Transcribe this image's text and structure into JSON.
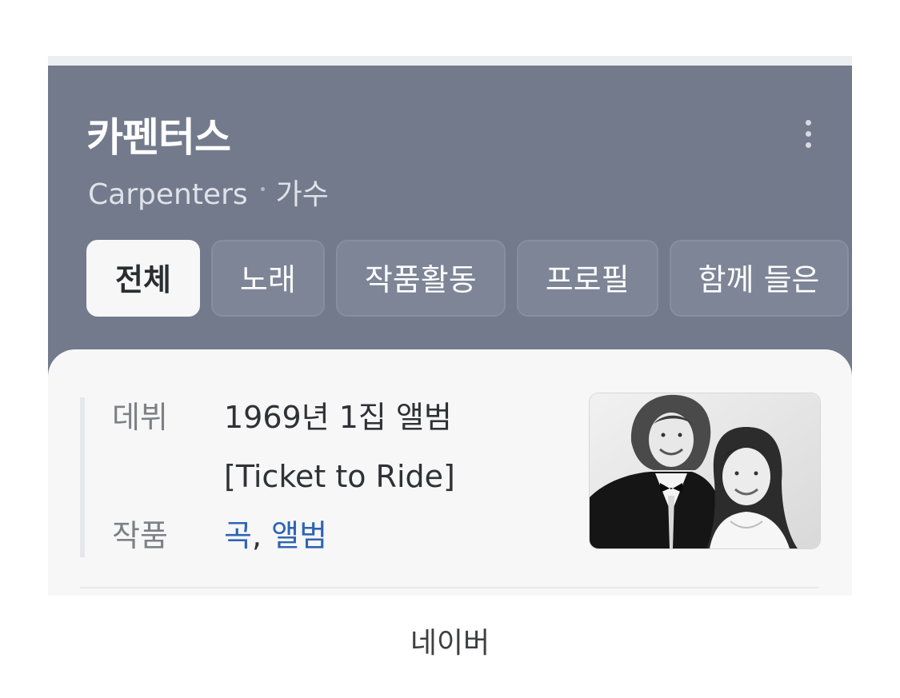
{
  "header": {
    "title": "카펜터스",
    "subtitle_name": "Carpenters",
    "subtitle_type": "가수",
    "more_icon": "more-vertical-icon",
    "background_color": "#727a8c"
  },
  "tabs": [
    {
      "label": "전체",
      "active": true
    },
    {
      "label": "노래",
      "active": false
    },
    {
      "label": "작품활동",
      "active": false
    },
    {
      "label": "프로필",
      "active": false
    },
    {
      "label": "함께 들은",
      "active": false
    }
  ],
  "info": {
    "debut_label": "데뷔",
    "debut_value_line1": "1969년 1집 앨범",
    "debut_value_line2": "[Ticket to Ride]",
    "works_label": "작품",
    "works_song": "곡",
    "works_separator": ",",
    "works_album": "앨범",
    "link_color": "#2f64b2"
  },
  "photo": {
    "description_icon": "artist-photo"
  },
  "caption": "네이버"
}
